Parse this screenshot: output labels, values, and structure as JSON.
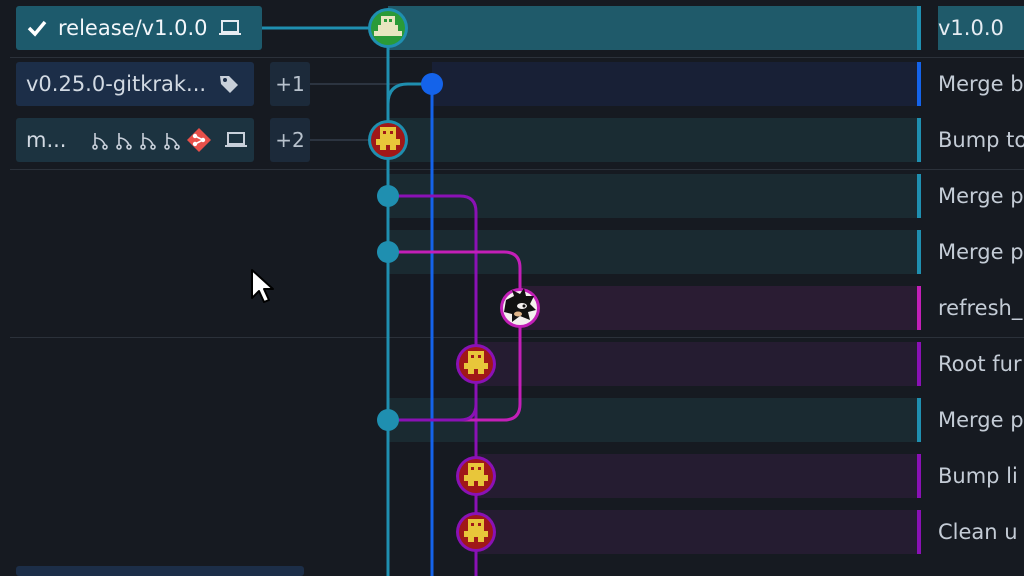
{
  "refs": {
    "release": {
      "label": "release/v1.0.0",
      "icons": [
        "check-icon",
        "laptop-icon"
      ]
    },
    "tag": {
      "label": "v0.25.0-gitkrak...",
      "extra": "+1",
      "icons": [
        "tag-icon"
      ]
    },
    "branch": {
      "label": "m...",
      "extra": "+2",
      "icons": [
        "fork-icon",
        "fork-icon",
        "fork-icon",
        "fork-icon",
        "git-provider-icon",
        "laptop-icon"
      ]
    }
  },
  "commits": [
    {
      "message": "v1.0.0",
      "lane": "teal",
      "avatar": "green-avatar"
    },
    {
      "message": "Merge b",
      "lane": "blue",
      "avatar": "dot"
    },
    {
      "message": "Bump to",
      "lane": "teal",
      "avatar": "red-avatar"
    },
    {
      "message": "Merge p",
      "lane": "teal",
      "avatar": "dot"
    },
    {
      "message": "Merge p",
      "lane": "teal",
      "avatar": "dot"
    },
    {
      "message": "refresh_",
      "lane": "magenta",
      "avatar": "sonic-avatar"
    },
    {
      "message": "Root fur",
      "lane": "purple",
      "avatar": "purple-avatar"
    },
    {
      "message": "Merge p",
      "lane": "teal",
      "avatar": "dot"
    },
    {
      "message": "Bump li",
      "lane": "purple",
      "avatar": "purple-avatar"
    },
    {
      "message": "Clean u",
      "lane": "purple",
      "avatar": "purple-avatar"
    }
  ],
  "colors": {
    "teal": "#1f8fb0",
    "blue": "#1463ea",
    "purple": "#8a11b5",
    "magenta": "#c31fb8",
    "bg": "#161a21"
  }
}
